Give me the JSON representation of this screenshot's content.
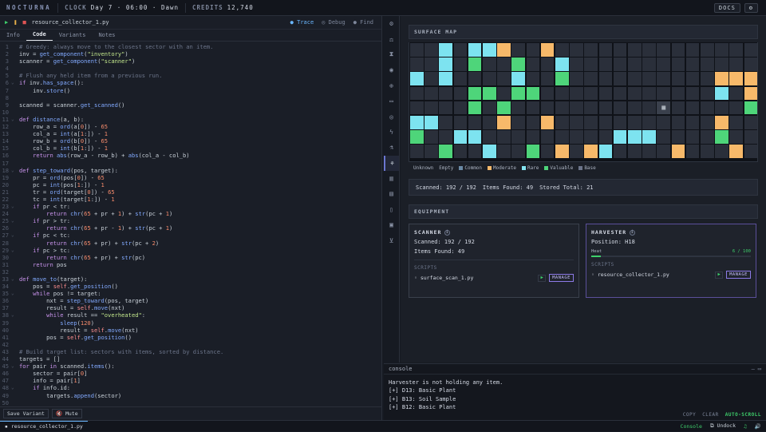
{
  "topbar": {
    "logo": "NOCTURNA",
    "clock_label": "CLOCK",
    "clock_value": "Day 7 · 06:00 · Dawn",
    "credits_label": "CREDITS",
    "credits_value": "12,740",
    "docs_label": "DOCS",
    "settings_icon": "gear-icon"
  },
  "editor": {
    "filename": "resource_collector_1.py",
    "trace_label": "Trace",
    "debug_label": "Debug",
    "find_label": "Find",
    "tabs": [
      "Info",
      "Code",
      "Variants",
      "Notes"
    ],
    "active_tab": "Code",
    "save_variant": "Save Variant",
    "mute": "Mute",
    "lines": [
      "# Greedy: always move to the closest sector with an item.",
      "inv = get_component(\"inventory\")",
      "scanner = get_component(\"scanner\")",
      "",
      "# Flush any held item from a previous run.",
      "if inv.has_space():",
      "    inv.store()",
      "",
      "scanned = scanner.get_scanned()",
      "",
      "def distance(a, b):",
      "    row_a = ord(a[0]) - 65",
      "    col_a = int(a[1:]) - 1",
      "    row_b = ord(b[0]) - 65",
      "    col_b = int(b[1:]) - 1",
      "    return abs(row_a - row_b) + abs(col_a - col_b)",
      "",
      "def step_toward(pos, target):",
      "    pr = ord(pos[0]) - 65",
      "    pc = int(pos[1:]) - 1",
      "    tr = ord(target[0]) - 65",
      "    tc = int(target[1:]) - 1",
      "    if pr < tr:",
      "        return chr(65 + pr + 1) + str(pc + 1)",
      "    if pr > tr:",
      "        return chr(65 + pr - 1) + str(pc + 1)",
      "    if pc < tc:",
      "        return chr(65 + pr) + str(pc + 2)",
      "    if pc > tc:",
      "        return chr(65 + pr) + str(pc)",
      "    return pos",
      "",
      "def move_to(target):",
      "    pos = self.get_position()",
      "    while pos != target:",
      "        nxt = step_toward(pos, target)",
      "        result = self.move(nxt)",
      "        while result == \"overheated\":",
      "            sleep(120)",
      "            result = self.move(nxt)",
      "        pos = self.get_position()",
      "",
      "# Build target list: sectors with items, sorted by distance.",
      "targets = []",
      "for pair in scanned.items():",
      "    sector = pair[0]",
      "    info = pair[1]",
      "    if info.id:",
      "        targets.append(sector)",
      ""
    ],
    "fold_lines": [
      6,
      11,
      18,
      23,
      25,
      27,
      29,
      33,
      35,
      38,
      45,
      48
    ]
  },
  "surface": {
    "title": "SURFACE MAP",
    "rows": [
      "..C.CCO..O...............O",
      "..C.M..M..C..............M..",
      "C.C....C..M..........OOO.....",
      "....MM.MM............C.O.....",
      "....M.M..........B.....M.O...",
      "CC....O..O...........O...O...",
      "M..CC.........CCC....M.......",
      "..M..C..M.O.OC....O...O.H.O.."
    ],
    "legend": [
      "Unknown",
      "Empty",
      "Common",
      "Moderate",
      "Rare",
      "Valuable",
      "Base"
    ],
    "colors": {
      "empty": "#2a2f3a",
      "common": "#7de3f0",
      "moderate": "#f7b96a",
      "valuable": "#4ed57a",
      "rare": "#85e6f2",
      "base": "#4a515e"
    }
  },
  "stats": {
    "scanned": "Scanned: 192 / 192",
    "items": "Items Found: 49",
    "stored": "Stored Total: 21"
  },
  "equipment": {
    "title": "EQUIPMENT",
    "scanner": {
      "name": "SCANNER",
      "line1": "Scanned: 192 / 192",
      "line2": "Items Found: 49",
      "scripts_label": "SCRIPTS",
      "script": "surface_scan_1.py",
      "manage": "MANAGE"
    },
    "harvester": {
      "name": "HARVESTER",
      "line1": "Position: H18",
      "heat_label": "Heat",
      "heat_value": "6 / 100",
      "heat_fraction": 0.06,
      "scripts_label": "SCRIPTS",
      "script": "resource_collector_1.py",
      "manage": "MANAGE"
    }
  },
  "console": {
    "title": "console",
    "lines": [
      "Harvester is not holding any item.",
      "[+] D13: Basic Plant",
      "[+] B13: Soil Sample",
      "[+] B12: Basic Plant"
    ],
    "copy": "COPY",
    "clear": "CLEAR",
    "autoscroll": "AUTO-SCROLL"
  },
  "status": {
    "file": "resource_collector_1.py",
    "console": "Console",
    "undock": "Undock"
  }
}
